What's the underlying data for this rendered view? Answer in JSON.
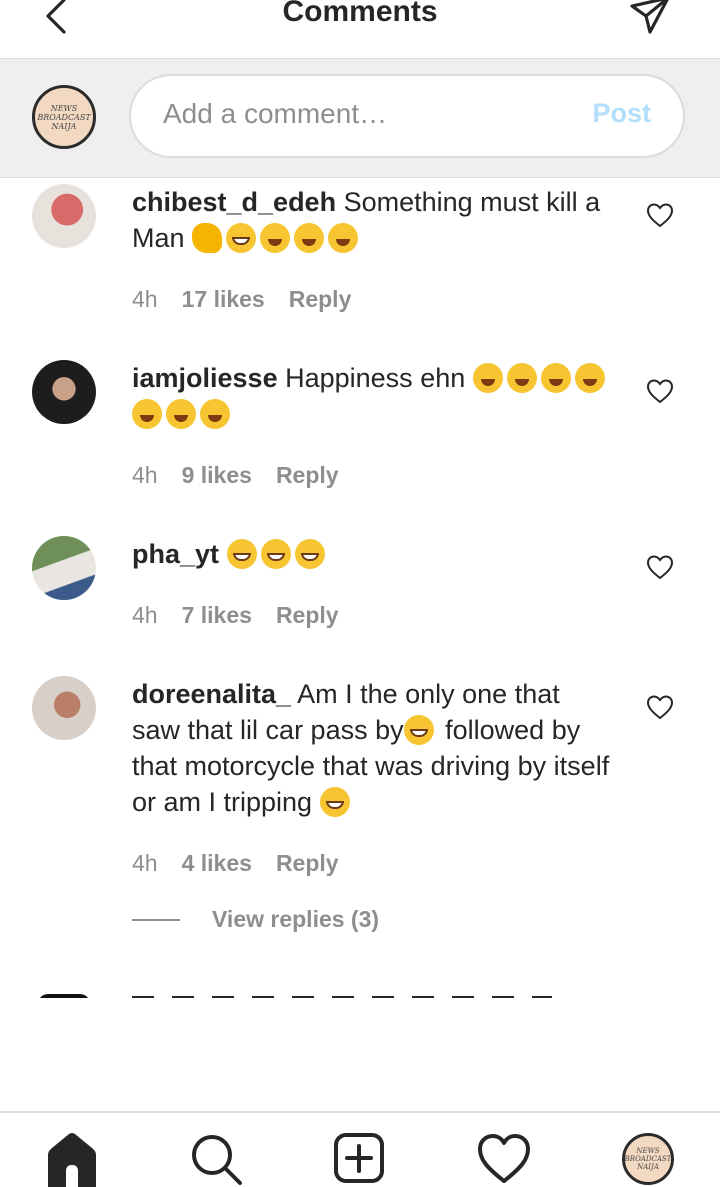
{
  "header": {
    "title": "Comments"
  },
  "compose": {
    "placeholder": "Add a comment…",
    "post_label": "Post",
    "avatar_text": [
      "NEWS",
      "BROADCAST",
      "NAIJA"
    ]
  },
  "comments": [
    {
      "username": "chibest_d_edeh",
      "text": "Something must kill a Man",
      "emojis": [
        "muscle",
        "grin",
        "rofl",
        "rofl",
        "rofl"
      ],
      "time": "4h",
      "likes": "17 likes",
      "reply": "Reply"
    },
    {
      "username": "iamjoliesse",
      "text": "Happiness ehn",
      "emojis": [
        "rofl",
        "rofl",
        "rofl",
        "rofl",
        "rofl",
        "rofl",
        "rofl"
      ],
      "time": "4h",
      "likes": "9 likes",
      "reply": "Reply"
    },
    {
      "username": "pha_yt",
      "text": "",
      "emojis": [
        "grin",
        "grin",
        "grin"
      ],
      "time": "4h",
      "likes": "7 likes",
      "reply": "Reply"
    },
    {
      "username": "doreenalita_",
      "text_a": "Am I the only one that saw that lil car pass by",
      "text_b": "followed by that motorcycle that was driving by itself or am I tripping",
      "time": "4h",
      "likes": "4 likes",
      "reply": "Reply"
    }
  ],
  "view_replies": "View replies (3)",
  "colors": {
    "post_disabled": "#b2dffc",
    "muted": "#8e8e8e",
    "text": "#262626",
    "emoji": "#f7c531"
  },
  "tabbar": {
    "icons": [
      "home-icon",
      "search-icon",
      "add-post-icon",
      "heart-icon",
      "profile-avatar"
    ]
  }
}
